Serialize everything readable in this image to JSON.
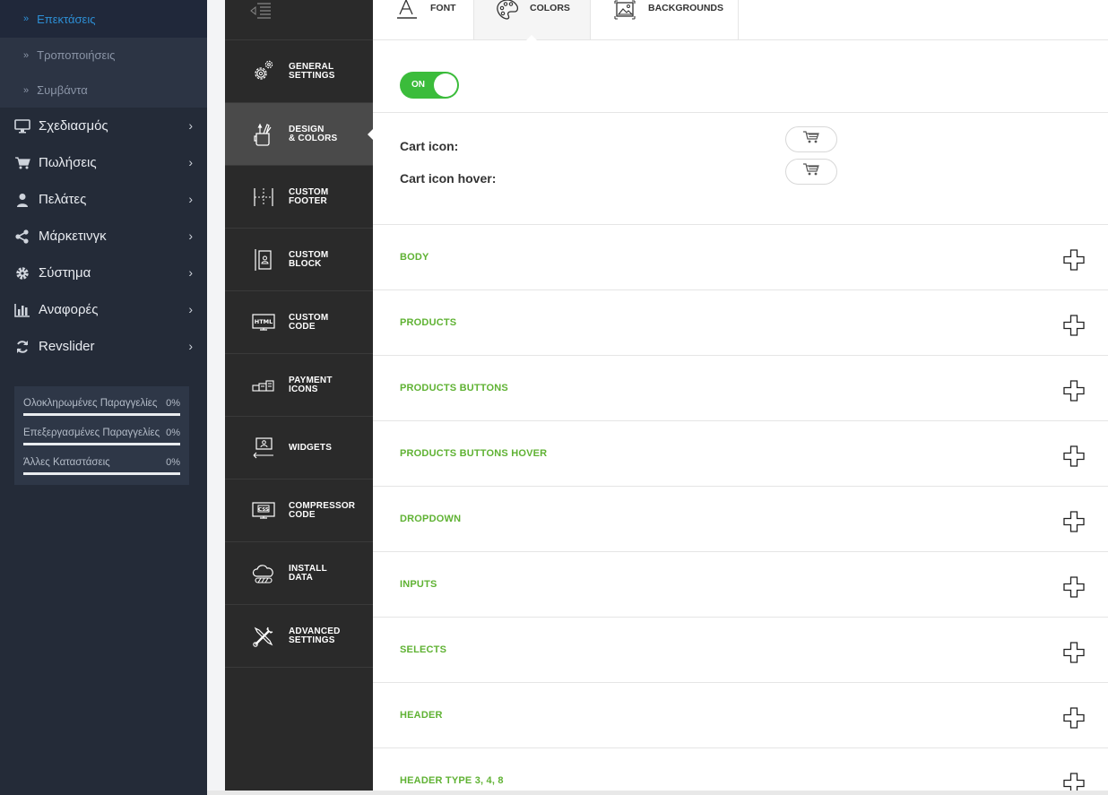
{
  "admin_sidebar": {
    "sub_items": [
      {
        "label": "Επεκτάσεις",
        "active": true
      },
      {
        "label": "Τροποποιήσεις",
        "active": false
      },
      {
        "label": "Συμβάντα",
        "active": false
      }
    ],
    "menu": [
      {
        "label": "Σχεδιασμός",
        "icon": "monitor-icon"
      },
      {
        "label": "Πωλήσεις",
        "icon": "cart-icon"
      },
      {
        "label": "Πελάτες",
        "icon": "user-icon"
      },
      {
        "label": "Μάρκετινγκ",
        "icon": "share-icon"
      },
      {
        "label": "Σύστημα",
        "icon": "gear-icon"
      },
      {
        "label": "Αναφορές",
        "icon": "bar-chart-icon"
      },
      {
        "label": "Revslider",
        "icon": "refresh-icon"
      }
    ],
    "stats": [
      {
        "label": "Ολοκληρωμένες Παραγγελίες",
        "value": "0%"
      },
      {
        "label": "Επεξεργασμένες Παραγγελίες",
        "value": "0%"
      },
      {
        "label": "Άλλες Καταστάσεις",
        "value": "0%"
      }
    ]
  },
  "theme_nav": {
    "items": [
      {
        "line1": "GENERAL",
        "line2": "SETTINGS",
        "icon": "gears-icon",
        "active": false
      },
      {
        "line1": "DESIGN",
        "line2": "& COLORS",
        "icon": "brush-cup-icon",
        "active": true
      },
      {
        "line1": "CUSTOM",
        "line2": "FOOTER",
        "icon": "footer-layout-icon",
        "active": false
      },
      {
        "line1": "CUSTOM",
        "line2": "BLOCK",
        "icon": "block-icon",
        "active": false
      },
      {
        "line1": "CUSTOM",
        "line2": "CODE",
        "icon": "html-code-icon",
        "active": false
      },
      {
        "line1": "PAYMENT",
        "line2": "ICONS",
        "icon": "payment-icon",
        "active": false
      },
      {
        "line1": "WIDGETS",
        "line2": "",
        "icon": "widget-icon",
        "active": false
      },
      {
        "line1": "COMPRESSOR",
        "line2": "CODE",
        "icon": "css-icon",
        "active": false
      },
      {
        "line1": "INSTALL",
        "line2": "DATA",
        "icon": "cloud-icon",
        "active": false
      },
      {
        "line1": "ADVANCED",
        "line2": "SETTINGS",
        "icon": "tools-icon",
        "active": false
      }
    ]
  },
  "tabs": {
    "font": "FONT",
    "colors": "COLORS",
    "backgrounds": "BACKGROUNDS"
  },
  "toggle": {
    "label": "ON"
  },
  "cart": {
    "icon_label": "Cart icon:",
    "hover_label": "Cart icon hover:"
  },
  "sections": [
    "BODY",
    "PRODUCTS",
    "PRODUCTS BUTTONS",
    "PRODUCTS BUTTONS HOVER",
    "DROPDOWN",
    "INPUTS",
    "SELECTS",
    "HEADER",
    "HEADER TYPE 3, 4, 8"
  ],
  "colors": {
    "accent_green": "#5fb233",
    "toggle_green": "#3bbc3b",
    "sidebar_bg": "#242b38",
    "active_link": "#2d8fd5"
  }
}
